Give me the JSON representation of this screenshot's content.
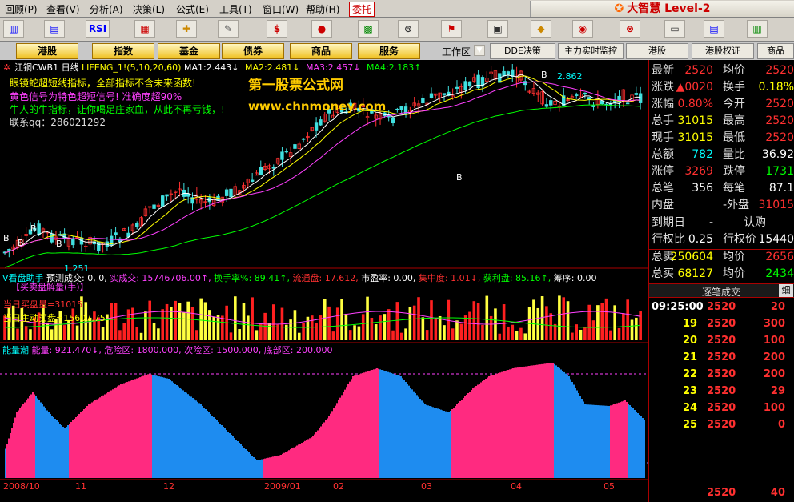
{
  "menu": {
    "items": [
      "回顾(P)",
      "查看(V)",
      "分析(A)",
      "决策(L)",
      "公式(E)",
      "工具(T)",
      "窗口(W)",
      "帮助(H)"
    ],
    "entrust": "委托",
    "brand": "大智慧 Level-2"
  },
  "toolbar": {
    "rsi": "RSI"
  },
  "nav": {
    "items": [
      "港股",
      "指数",
      "基金",
      "债券",
      "商品",
      "服务"
    ],
    "workspace": "工作区",
    "right_items": [
      "DDE决策",
      "主力实时监控",
      "港股",
      "港股权证",
      "商品"
    ]
  },
  "chart": {
    "title": "江铜CWB1 日线",
    "ma_label": "LIFENG_1!(5,10,20,60)",
    "ma": [
      {
        "label": "MA1:",
        "value": "2.443",
        "arrow": "↓",
        "color": "#ffffff"
      },
      {
        "label": "MA2:",
        "value": "2.481",
        "arrow": "↓",
        "color": "#ffff00"
      },
      {
        "label": "MA3:",
        "value": "2.457",
        "arrow": "↓",
        "color": "#ff40ff"
      },
      {
        "label": "MA4:",
        "value": "2.183",
        "arrow": "↑",
        "color": "#00ff00"
      }
    ],
    "notes": [
      {
        "text": "眼镜蛇超短线指标，全部指标不含未来函数!",
        "color": "#ffff00"
      },
      {
        "text": "黄色信号为特色超短信号! 准确度超90%",
        "color": "#ff40ff"
      },
      {
        "text": "牛人的牛指标，让你喝足庄家血，从此不再亏钱，!",
        "color": "#00ff00"
      },
      {
        "text": "联系qq：286021292",
        "color": "#dddddd"
      }
    ],
    "watermark_title": "第一股票公式网",
    "watermark_url": "www.chnmoney.com",
    "high_label": "2.862",
    "low_label": "1.251",
    "b": "B",
    "vol_header": [
      {
        "text": "V看盘助手",
        "color": "#00ffff"
      },
      {
        "text": "预测成交: 0, 0,",
        "color": "#ffffff"
      },
      {
        "text": "实成交: 15746706.00↑,",
        "color": "#ff40ff"
      },
      {
        "text": "换手率%: 89.41↑,",
        "color": "#00ff00"
      },
      {
        "text": "流通盘: 17.612,",
        "color": "#ff3030"
      },
      {
        "text": "市盈率: 0.00,",
        "color": "#ffffff"
      },
      {
        "text": "集中度: 1.01↓,",
        "color": "#ff3030"
      },
      {
        "text": "获利盘: 85.16↑,",
        "color": "#00ff00"
      },
      {
        "text": "筹序: 0.00",
        "color": "#ffffff"
      }
    ],
    "vol_sub": "【买卖盘解量(手)】",
    "vol_buy": "当日买盘量=31015",
    "vol_main": "当日主动买盘=15607.75",
    "energy_header": [
      {
        "text": "能量潮",
        "color": "#00ffff"
      },
      {
        "text": "能量: 921.470↓,",
        "color": "#ff40ff"
      },
      {
        "text": "危险区: 1800.000,",
        "color": "#ff40ff"
      },
      {
        "text": "次险区: 1500.000,",
        "color": "#ff40ff"
      },
      {
        "text": "底部区: 200.000",
        "color": "#ff40ff"
      }
    ],
    "dates": [
      "2008/10",
      "11",
      "12",
      "2009/01",
      "02",
      "03",
      "04",
      "05"
    ]
  },
  "quote": {
    "rows": [
      {
        "l": "最新",
        "v": "2520",
        "vc": "#ff3030",
        "l2": "均价",
        "v2": "2520",
        "v2c": "#ff3030"
      },
      {
        "l": "涨跌",
        "v": "▲0020",
        "vc": "#ff3030",
        "l2": "换手",
        "v2": "0.18%",
        "v2c": "#ffff00"
      },
      {
        "l": "涨幅",
        "v": "0.80%",
        "vc": "#ff3030",
        "l2": "今开",
        "v2": "2520",
        "v2c": "#ff3030"
      },
      {
        "l": "总手",
        "v": "31015",
        "vc": "#ffff00",
        "l2": "最高",
        "v2": "2520",
        "v2c": "#ff3030"
      },
      {
        "l": "现手",
        "v": "31015",
        "vc": "#ffff00",
        "l2": "最低",
        "v2": "2520",
        "v2c": "#ff3030"
      },
      {
        "l": "总额",
        "v": "782",
        "vc": "#00ffff",
        "l2": "量比",
        "v2": "36.92",
        "v2c": "#ffffff"
      },
      {
        "l": "涨停",
        "v": "3269",
        "vc": "#ff3030",
        "l2": "跌停",
        "v2": "1731",
        "v2c": "#00ff00"
      },
      {
        "l": "总笔",
        "v": "356",
        "vc": "#ffffff",
        "l2": "每笔",
        "v2": "87.1",
        "v2c": "#ffffff"
      },
      {
        "l": "内盘",
        "v": "",
        "vc": "#00ff00",
        "l2": "-外盘",
        "v2": "31015",
        "v2c": "#ff3030"
      }
    ],
    "rows2": [
      {
        "l": "到期日",
        "v": "-",
        "vc": "#ffffff",
        "l2": "认购",
        "v2": "",
        "v2c": "#ff3030"
      },
      {
        "l": "行权比",
        "v": "0.25",
        "vc": "#ffffff",
        "l2": "行权价",
        "v2": "15440",
        "v2c": "#ffffff"
      }
    ],
    "sell": {
      "l": "总卖",
      "v": "250604",
      "vc": "#ffff00",
      "l2": "均价",
      "v2": "2656",
      "v2c": "#ff3030"
    },
    "buy": {
      "l": "总买",
      "v": "68127",
      "vc": "#ffff00",
      "l2": "均价",
      "v2": "2434",
      "v2c": "#00ff00"
    },
    "tick_title": "逐笔成交",
    "tick_btn": "细",
    "ticks": [
      {
        "t": "09:25:00",
        "p": "2520",
        "v": "20"
      },
      {
        "t": "19",
        "p": "2520",
        "v": "300"
      },
      {
        "t": "20",
        "p": "2520",
        "v": "100"
      },
      {
        "t": "21",
        "p": "2520",
        "v": "200"
      },
      {
        "t": "22",
        "p": "2520",
        "v": "200"
      },
      {
        "t": "23",
        "p": "2520",
        "v": "29"
      },
      {
        "t": "24",
        "p": "2520",
        "v": "100"
      },
      {
        "t": "25",
        "p": "2520",
        "v": "0"
      },
      {
        "t": "",
        "p": "2520",
        "v": "40"
      }
    ]
  }
}
